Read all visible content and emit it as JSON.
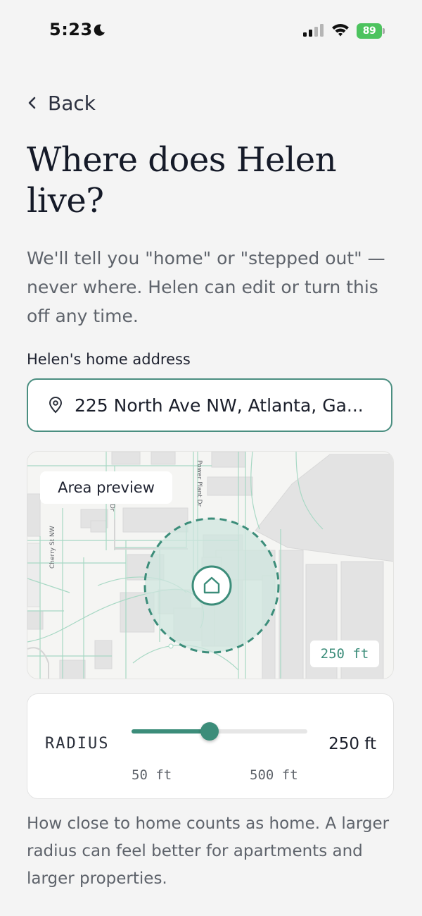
{
  "status_bar": {
    "time": "5:23",
    "battery": "89"
  },
  "nav": {
    "back_label": "Back"
  },
  "title": "Where does Helen live?",
  "subtitle": "We'll tell you \"home\" or \"stepped out\" — never where. Helen can edit or turn this off any time.",
  "address": {
    "label": "Helen's home address",
    "value": "225 North Ave NW, Atlanta, Ga..."
  },
  "map": {
    "badge": "Area preview",
    "radius_tag": "250 ft",
    "streets": {
      "power_plant": "Power Plant Dr",
      "dr": "Dr",
      "cherry": "Cherry St NW"
    }
  },
  "radius": {
    "title": "RADIUS",
    "value_label": "250 ft",
    "min_label": "50 ft",
    "max_label": "500 ft",
    "min": 50,
    "max": 500,
    "value": 250
  },
  "helper": "How close to home counts as home. A larger radius can feel better for apartments and larger properties.",
  "colors": {
    "accent": "#3c8d7a",
    "field_border": "#4a8e80",
    "background": "#f4f4f4",
    "battery": "#4cc35e"
  },
  "icons": {
    "moon": "moon-icon",
    "signal": "signal-icon",
    "wifi": "wifi-icon",
    "back": "chevron-left-icon",
    "pin": "location-pin-icon",
    "home": "home-icon"
  }
}
